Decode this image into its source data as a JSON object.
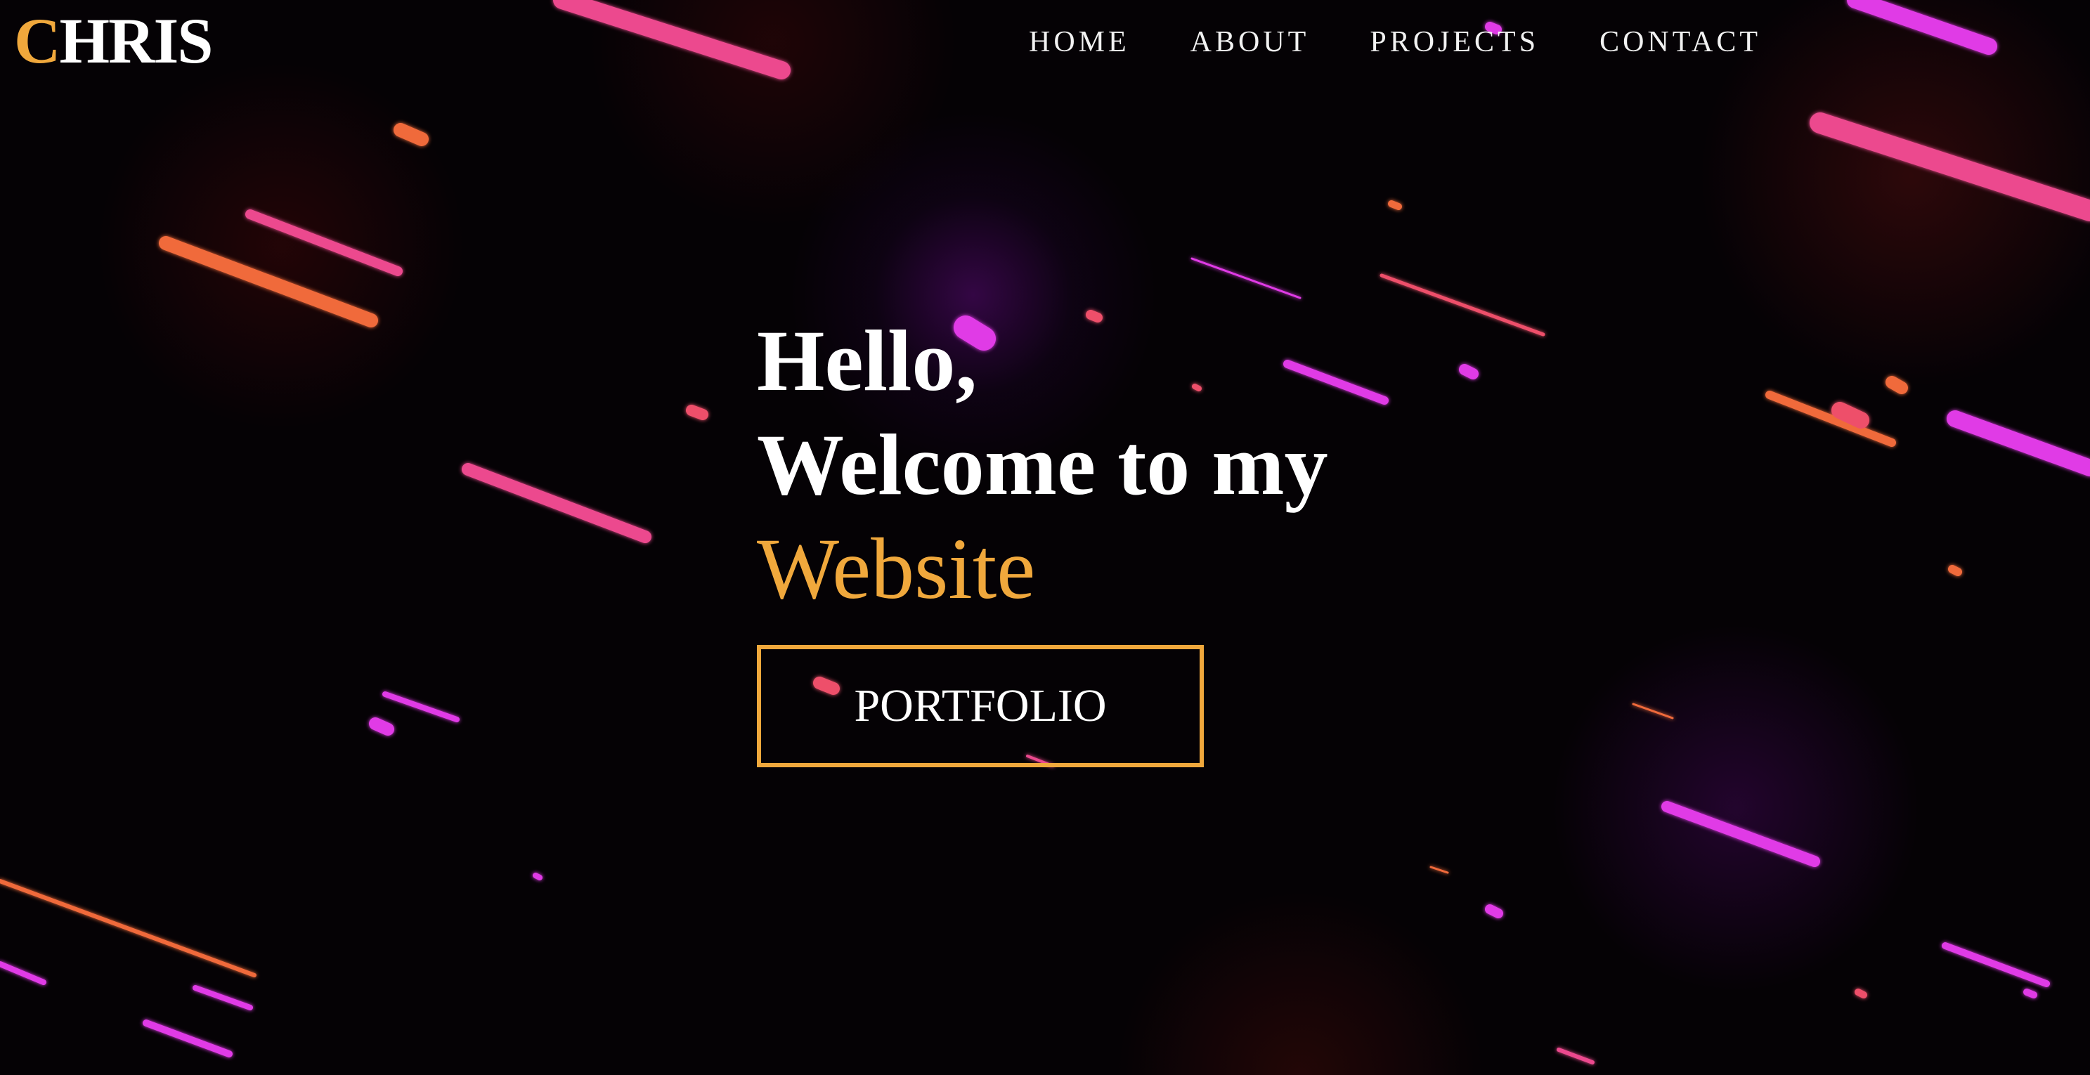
{
  "brand": {
    "initial": "C",
    "rest": "HRIS"
  },
  "nav": {
    "items": [
      {
        "label": "HOME"
      },
      {
        "label": "ABOUT"
      },
      {
        "label": "PROJECTS"
      },
      {
        "label": "CONTACT"
      }
    ]
  },
  "hero": {
    "line1": "Hello,",
    "line2": "Welcome to my",
    "highlight": "Website",
    "button_label": "PORTFOLIO"
  },
  "colors": {
    "accent": "#f0a83c",
    "text": "#ffffff",
    "background": "#050205",
    "streak_magenta": "#e03ae6",
    "streak_pink": "#ec4a8e",
    "streak_orange": "#f06a3a",
    "streak_red": "#ee4f6a"
  }
}
